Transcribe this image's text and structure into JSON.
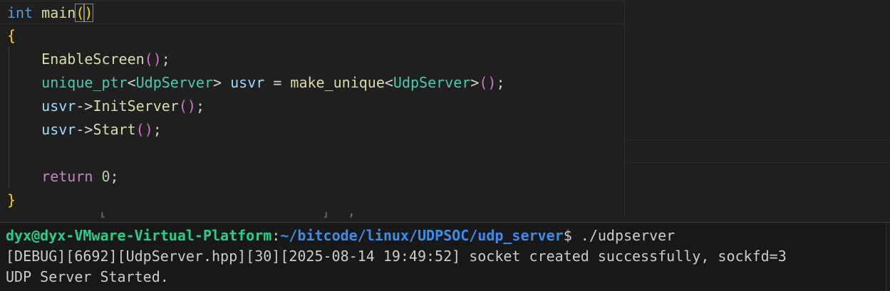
{
  "editor": {
    "lines": [
      {
        "type": "int",
        "name": "main",
        "open": "(",
        "close": ")"
      },
      {
        "text": "{"
      },
      {
        "fn": "EnableScreen",
        "open": "(",
        "close": ")",
        "end": ";"
      },
      {
        "type": "unique_ptr",
        "lt": "<",
        "tparam": "UdpServer",
        "gt": ">",
        "var": "usvr",
        "eq": "=",
        "fn": "make_unique",
        "lt2": "<",
        "tparam2": "UdpServer",
        "gt2": ">",
        "open": "(",
        "close": ")",
        "end": ";"
      },
      {
        "obj": "usvr",
        "arrow": "->",
        "fn": "InitServer",
        "open": "(",
        "close": ")",
        "end": ";"
      },
      {
        "obj": "usvr",
        "arrow": "->",
        "fn": "Start",
        "open": "(",
        "close": ")",
        "end": ";"
      },
      {
        "text": ""
      },
      {
        "kw": "return",
        "num": "0",
        "end": ";"
      },
      {
        "text": "}"
      }
    ]
  },
  "ghost_line": "[                         ]  ;;;",
  "terminal": {
    "prompt": {
      "user_host": "dyx@dyx-VMware-Virtual-Platform",
      "colon": ":",
      "path": "~/bitcode/linux/UDPSOC/udp_server",
      "dollar": "$",
      "command": " ./udpserver"
    },
    "output": [
      "[DEBUG][6692][UdpServer.hpp][30][2025-08-14 19:49:52] socket created successfully, sockfd=3",
      "UDP Server Started."
    ]
  },
  "colors": {
    "background": "#1f1f1f",
    "terminal_background": "#181818",
    "keyword": "#569cd6",
    "function": "#dcdcaa",
    "type": "#4ec9b0",
    "variable": "#9cdcfe",
    "control": "#c586c0",
    "number": "#b5cea8",
    "bracket_level1": "#ffd700",
    "bracket_level2": "#da70d6",
    "prompt_user": "#23d18b",
    "prompt_path": "#3b8eea"
  }
}
